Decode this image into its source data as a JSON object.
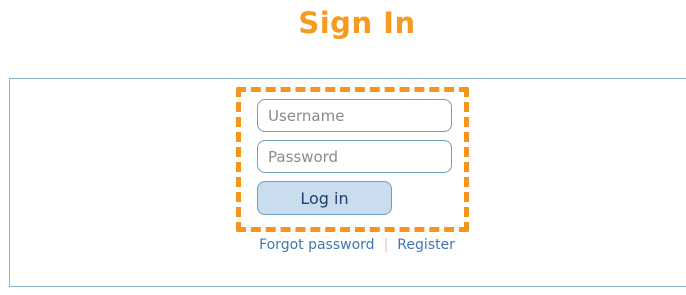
{
  "header": {
    "title": "Sign In"
  },
  "form": {
    "username_placeholder": "Username",
    "password_placeholder": "Password",
    "login_label": "Log in"
  },
  "links": {
    "forgot_password": "Forgot password",
    "separator": "|",
    "register": "Register"
  },
  "colors": {
    "accent": "#f79a1e",
    "highlight_border": "#f7941d",
    "link": "#3f78ae",
    "button_bg": "#c9ddee",
    "field_border": "#6e9fc1"
  }
}
